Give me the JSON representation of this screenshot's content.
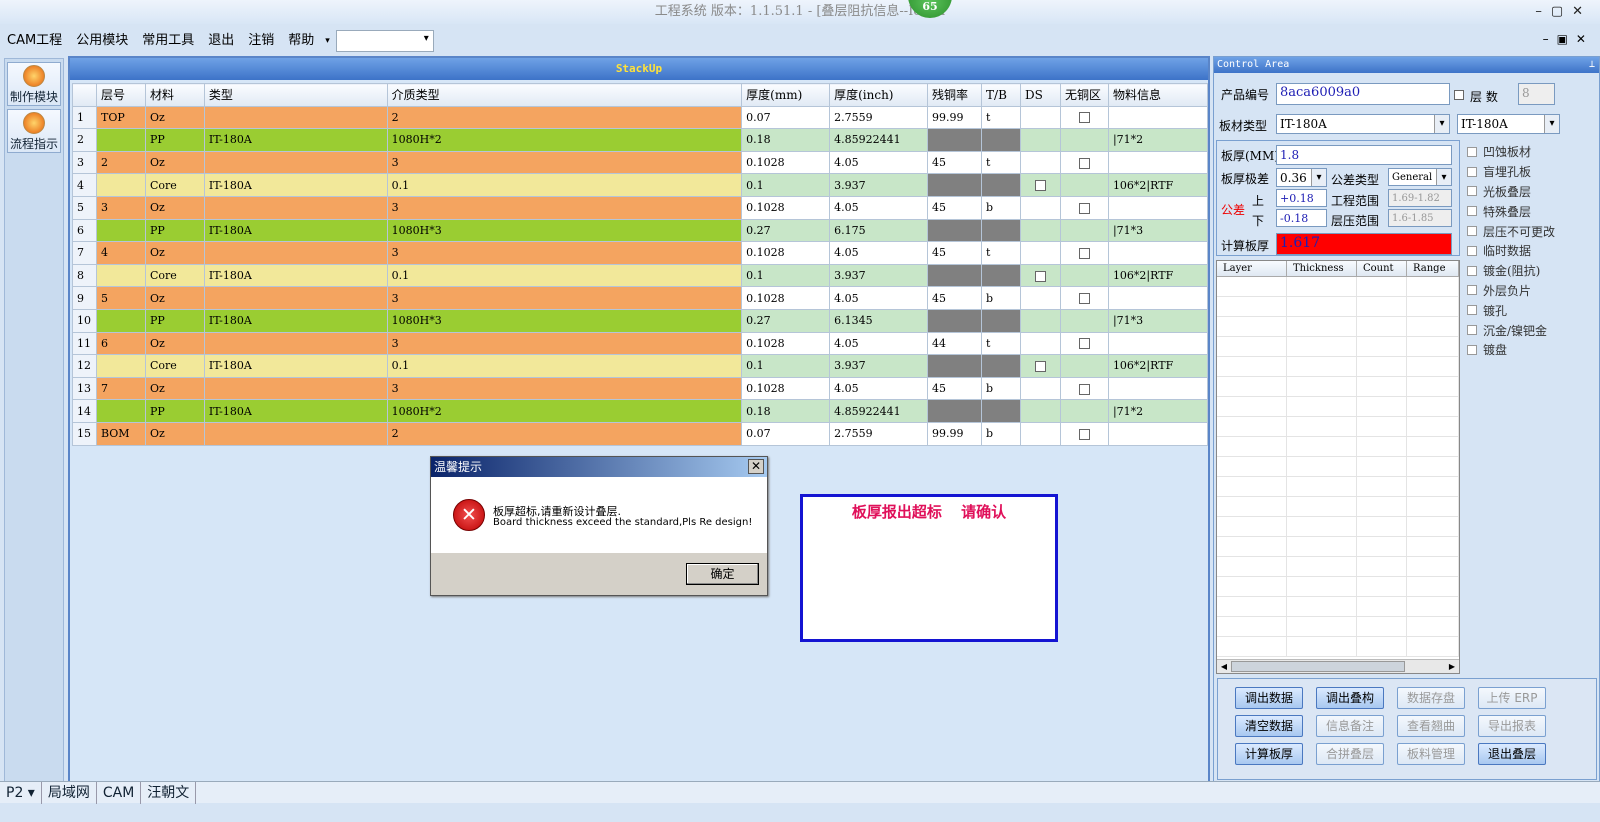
{
  "titlebar": {
    "title": "工程系统  版本：1.1.51.1 - [叠层阻抗信息--Iconn",
    "badge": "65"
  },
  "menu": [
    "CAM工程",
    "公用模块",
    "常用工具",
    "退出",
    "注销",
    "帮助"
  ],
  "leftnav": [
    {
      "label": "制作模块"
    },
    {
      "label": "流程指示"
    }
  ],
  "stackup": {
    "title": "StackUp",
    "headers": [
      "层号",
      "材料",
      "类型",
      "介质类型",
      "厚度(mm)",
      "厚度(inch)",
      "残铜率",
      "T/B",
      "DS",
      "无铜区",
      "物料信息"
    ],
    "rows": [
      {
        "n": "1",
        "layer": "TOP",
        "mat": "Oz",
        "type": "",
        "med": "2",
        "mm": "0.07",
        "inch": "2.7559",
        "cu": "99.99",
        "tb": "t",
        "ds": "",
        "nocu": "box",
        "info": "",
        "kind": "cu"
      },
      {
        "n": "2",
        "layer": "",
        "mat": "PP",
        "type": "IT-180A",
        "med": "1080H*2",
        "mm": "0.18",
        "inch": "4.85922441",
        "cu": "",
        "tb": "",
        "ds": "",
        "nocu": "",
        "info": "|71*2",
        "kind": "pp"
      },
      {
        "n": "3",
        "layer": "2",
        "mat": "Oz",
        "type": "",
        "med": "3",
        "mm": "0.1028",
        "inch": "4.05",
        "cu": "45",
        "tb": "t",
        "ds": "",
        "nocu": "box",
        "info": "",
        "kind": "cu"
      },
      {
        "n": "4",
        "layer": "",
        "mat": "Core",
        "type": "IT-180A",
        "med": "0.1",
        "mm": "0.1",
        "inch": "3.937",
        "cu": "",
        "tb": "",
        "ds": "box",
        "nocu": "",
        "info": "106*2|RTF",
        "kind": "core"
      },
      {
        "n": "5",
        "layer": "3",
        "mat": "Oz",
        "type": "",
        "med": "3",
        "mm": "0.1028",
        "inch": "4.05",
        "cu": "45",
        "tb": "b",
        "ds": "",
        "nocu": "box",
        "info": "",
        "kind": "cu"
      },
      {
        "n": "6",
        "layer": "",
        "mat": "PP",
        "type": "IT-180A",
        "med": "1080H*3",
        "mm": "0.27",
        "inch": "6.175",
        "cu": "",
        "tb": "",
        "ds": "",
        "nocu": "",
        "info": "|71*3",
        "kind": "pp"
      },
      {
        "n": "7",
        "layer": "4",
        "mat": "Oz",
        "type": "",
        "med": "3",
        "mm": "0.1028",
        "inch": "4.05",
        "cu": "45",
        "tb": "t",
        "ds": "",
        "nocu": "box",
        "info": "",
        "kind": "cu"
      },
      {
        "n": "8",
        "layer": "",
        "mat": "Core",
        "type": "IT-180A",
        "med": "0.1",
        "mm": "0.1",
        "inch": "3.937",
        "cu": "",
        "tb": "",
        "ds": "box",
        "nocu": "",
        "info": "106*2|RTF",
        "kind": "core"
      },
      {
        "n": "9",
        "layer": "5",
        "mat": "Oz",
        "type": "",
        "med": "3",
        "mm": "0.1028",
        "inch": "4.05",
        "cu": "45",
        "tb": "b",
        "ds": "",
        "nocu": "box",
        "info": "",
        "kind": "cu"
      },
      {
        "n": "10",
        "layer": "",
        "mat": "PP",
        "type": "IT-180A",
        "med": "1080H*3",
        "mm": "0.27",
        "inch": "6.1345",
        "cu": "",
        "tb": "",
        "ds": "",
        "nocu": "",
        "info": "|71*3",
        "kind": "pp"
      },
      {
        "n": "11",
        "layer": "6",
        "mat": "Oz",
        "type": "",
        "med": "3",
        "mm": "0.1028",
        "inch": "4.05",
        "cu": "44",
        "tb": "t",
        "ds": "",
        "nocu": "box",
        "info": "",
        "kind": "cu"
      },
      {
        "n": "12",
        "layer": "",
        "mat": "Core",
        "type": "IT-180A",
        "med": "0.1",
        "mm": "0.1",
        "inch": "3.937",
        "cu": "",
        "tb": "",
        "ds": "box",
        "nocu": "",
        "info": "106*2|RTF",
        "kind": "core"
      },
      {
        "n": "13",
        "layer": "7",
        "mat": "Oz",
        "type": "",
        "med": "3",
        "mm": "0.1028",
        "inch": "4.05",
        "cu": "45",
        "tb": "b",
        "ds": "",
        "nocu": "box",
        "info": "",
        "kind": "cu"
      },
      {
        "n": "14",
        "layer": "",
        "mat": "PP",
        "type": "IT-180A",
        "med": "1080H*2",
        "mm": "0.18",
        "inch": "4.85922441",
        "cu": "",
        "tb": "",
        "ds": "",
        "nocu": "",
        "info": "|71*2",
        "kind": "pp"
      },
      {
        "n": "15",
        "layer": "BOM",
        "mat": "Oz",
        "type": "",
        "med": "2",
        "mm": "0.07",
        "inch": "2.7559",
        "cu": "99.99",
        "tb": "b",
        "ds": "",
        "nocu": "box",
        "info": "",
        "kind": "cu"
      }
    ]
  },
  "dialog": {
    "title": "温馨提示",
    "msg_cn": "板厚超标,请重新设计叠层.",
    "msg_en": "Board thickness exceed the standard,Pls Re design!",
    "ok": "确定"
  },
  "warnbox": {
    "text": "板厚报出超标  请确认"
  },
  "control": {
    "title": "Control Area",
    "product_label": "产品编号",
    "product_no": "8aca6009a0",
    "layers_label": "层 数",
    "layers": "8",
    "board_type_label": "板材类型",
    "board_type": "IT-180A",
    "board_type2": "IT-180A",
    "thickness_label": "板厚(MM)",
    "thickness": "1.8",
    "tol_label": "板厚极差",
    "tol": "0.36",
    "tol_type_label": "公差类型",
    "tol_type": "General",
    "gongcha": "公差",
    "upper_label": "上",
    "upper": "+0.18",
    "lower_label": "下",
    "lower": "-0.18",
    "eng_range_label": "工程范围",
    "eng_range": "1.69-1.82",
    "press_range_label": "层压范围",
    "press_range": "1.6-1.85",
    "calc_label": "计算板厚",
    "calc": "1.617",
    "table_headers": [
      "Layer",
      "Thickness",
      "Count",
      "Range"
    ],
    "checkboxes": [
      "凹蚀板材",
      "盲埋孔板",
      "光板叠层",
      "特殊叠层",
      "层压不可更改",
      "临时数据",
      "镀金(阻抗)",
      "外层负片",
      "镀孔",
      "沉金/镍钯金",
      "镀盘"
    ],
    "buttons": [
      {
        "label": "调出数据",
        "enabled": true
      },
      {
        "label": "调出叠构",
        "enabled": true
      },
      {
        "label": "数据存盘",
        "enabled": false
      },
      {
        "label": "上传 ERP",
        "enabled": false
      },
      {
        "label": "清空数据",
        "enabled": true
      },
      {
        "label": "信息备注",
        "enabled": false
      },
      {
        "label": "查看翘曲",
        "enabled": false
      },
      {
        "label": "导出报表",
        "enabled": false
      },
      {
        "label": "计算板厚",
        "enabled": true
      },
      {
        "label": "合拼叠层",
        "enabled": false
      },
      {
        "label": "板料管理",
        "enabled": false
      },
      {
        "label": "退出叠层",
        "enabled": true
      }
    ]
  },
  "statusbar": [
    "P2",
    "局域网",
    "CAM",
    "汪朝文"
  ],
  "colors": {
    "copper": "#f4a460",
    "pp": "#9acd32",
    "core": "#f2e89a",
    "calc_bg": "#ff0000",
    "warn_border": "#1414d2",
    "warn_text": "#e0105a"
  }
}
